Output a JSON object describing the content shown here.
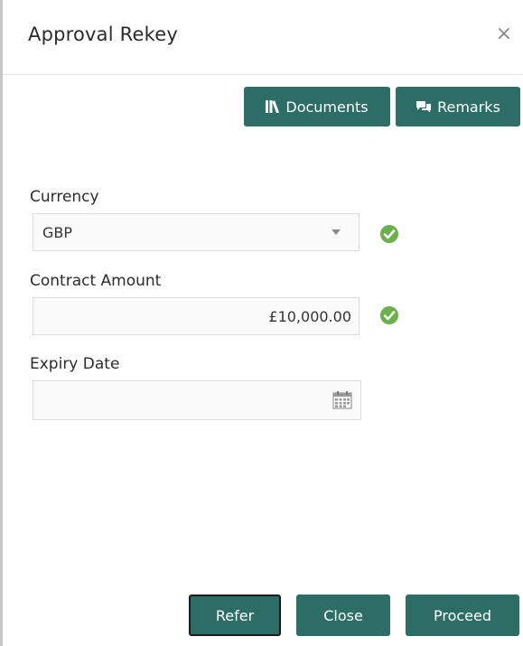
{
  "dialog": {
    "title": "Approval Rekey",
    "close_symbol": "×"
  },
  "toolbar": {
    "documents_label": "Documents",
    "documents_icon": "documents-icon",
    "remarks_label": "Remarks",
    "remarks_icon": "remarks-icon"
  },
  "fields": {
    "currency": {
      "label": "Currency",
      "value": "GBP",
      "validated": true
    },
    "contract_amount": {
      "label": "Contract Amount",
      "value": "£10,000.00",
      "validated": true
    },
    "expiry_date": {
      "label": "Expiry Date",
      "value": ""
    }
  },
  "footer": {
    "refer_label": "Refer",
    "close_label": "Close",
    "proceed_label": "Proceed"
  },
  "colors": {
    "primary_button": "#2c6e65",
    "check_green": "#6ab04c"
  }
}
